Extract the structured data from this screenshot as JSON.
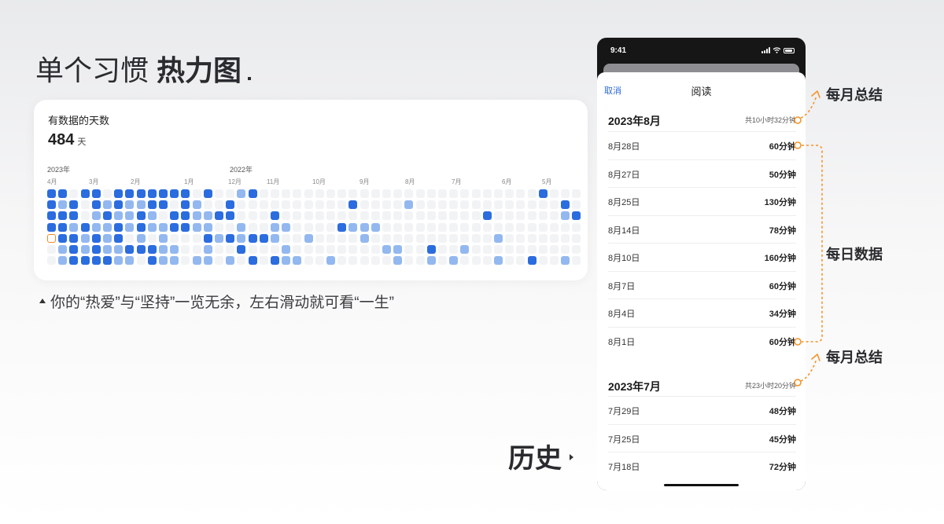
{
  "heading": {
    "regular": "单个习惯",
    "bold": "热力图"
  },
  "heatmap": {
    "title": "有数据的天数",
    "count": "484",
    "count_unit": "天",
    "years": [
      "2023年",
      "2022年"
    ],
    "months": [
      "4月",
      "3月",
      "2月",
      "1月",
      "12月",
      "11月",
      "10月",
      "9月",
      "8月",
      "7月",
      "6月",
      "5月"
    ],
    "colors": {
      "dark": "#2b6cdf",
      "light": "#93b8f0",
      "empty": "#f2f3f5",
      "today": "#f08a24"
    },
    "grid": [
      "DD.DD.DDDDDDD.D..LD.........................D..........D...L..L..",
      "DLD.DLDLLDD.DL..D..........D....L.............D.L...............",
      "DDD.LDLLDL.DDLLDD...D..................D......LD.................",
      "DDLDLLDLDLLDDLL..L..LL....DLLL..................L..L...........L...",
      "TDDLDLD.L.L...DLDLDDL..L....L...........L..........................",
      ".LDLDLLDDDLL..L..D...L........LL..D..L................L.............",
      ".LDDDDLL.DLL.LL.L.D.DLL..L.....L..L.L...L..D..L...L.L.....L...L......"
    ]
  },
  "caption": "你的“热爱”与“坚持”一览无余，左右滑动就可看“一生”",
  "history_label": "历史",
  "phone": {
    "status_time": "9:41",
    "sheet": {
      "cancel": "取消",
      "title": "阅读"
    },
    "months": [
      {
        "name": "2023年8月",
        "total": "共10小时32分钟",
        "days": [
          {
            "date": "8月28日",
            "duration": "60分钟"
          },
          {
            "date": "8月27日",
            "duration": "50分钟"
          },
          {
            "date": "8月25日",
            "duration": "130分钟"
          },
          {
            "date": "8月14日",
            "duration": "78分钟"
          },
          {
            "date": "8月10日",
            "duration": "160分钟"
          },
          {
            "date": "8月7日",
            "duration": "60分钟"
          },
          {
            "date": "8月4日",
            "duration": "34分钟"
          },
          {
            "date": "8月1日",
            "duration": "60分钟"
          }
        ]
      },
      {
        "name": "2023年7月",
        "total": "共23小时20分钟",
        "days": [
          {
            "date": "7月29日",
            "duration": "48分钟"
          },
          {
            "date": "7月25日",
            "duration": "45分钟"
          },
          {
            "date": "7月18日",
            "duration": "72分钟"
          }
        ]
      }
    ]
  },
  "annotations": {
    "monthly_summary": "每月总结",
    "daily_data": "每日数据",
    "accent_color": "#f5942a"
  }
}
